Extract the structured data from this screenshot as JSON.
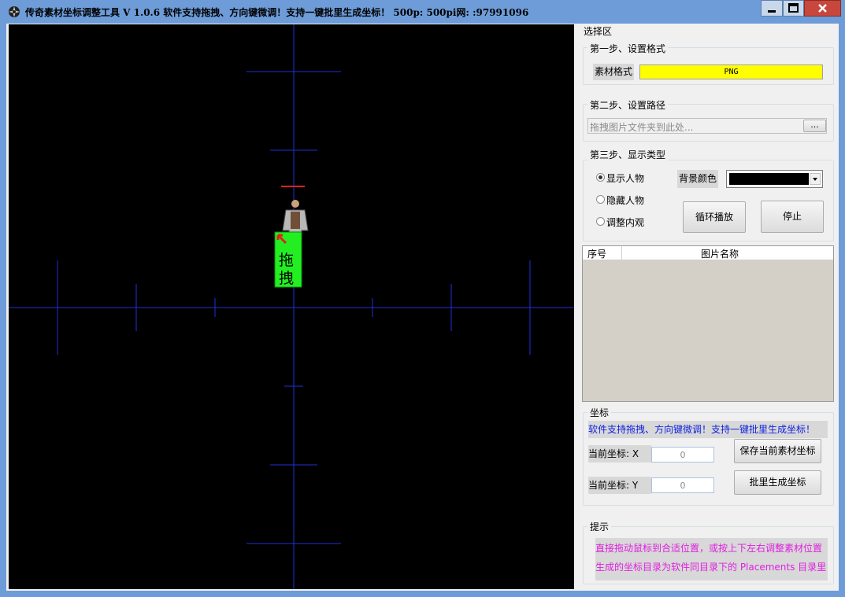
{
  "window": {
    "title": "传奇素材坐标调整工具 V 1.0.6  软件支持拖拽、方向键微调！支持一键批里生成坐标！ 500p: 500pi网: :97991096",
    "controls": {
      "minimize": "minimize",
      "maximize": "maximize",
      "close": "close"
    }
  },
  "canvas": {
    "background": "#000000",
    "crosshair_color": "#1f2fd8",
    "origin_marker_color": "#e02020",
    "drag_handle": {
      "line1": "拖",
      "line2": "拽",
      "color": "#22ee22"
    }
  },
  "panel": {
    "title": "选择区",
    "step1": {
      "title": "第一步、设置格式",
      "format_label": "素材格式",
      "format_value": "PNG",
      "format_bg": "#ffff00"
    },
    "step2": {
      "title": "第二步、设置路径",
      "path_placeholder": "拖拽图片文件夹到此处...",
      "browse_label": "..."
    },
    "step3": {
      "title": "第三步、显示类型",
      "radios": [
        "显示人物",
        "隐藏人物",
        "调整内观"
      ],
      "selected": "显示人物",
      "bg_color_label": "背景颜色",
      "bg_color_value": "#000000",
      "loop_button": "循环播放",
      "stop_button": "停止"
    },
    "list": {
      "col_index": "序号",
      "col_name": "图片名称"
    },
    "coords": {
      "title": "坐标",
      "notice": "软件支持拖拽、方向键微调！支持一键批里生成坐标！",
      "x_label": "当前坐标: X",
      "x_value": "0",
      "y_label": "当前坐标: Y",
      "y_value": "0",
      "save_button": "保存当前素材坐标",
      "batch_button": "批里生成坐标"
    },
    "tips": {
      "title": "提示",
      "line1": "直接拖动鼠标到合适位置，或按上下左右调整素材位置",
      "line2": "生成的坐标目录为软件同目录下的 Placements 目录里",
      "color": "#e020e0"
    }
  }
}
